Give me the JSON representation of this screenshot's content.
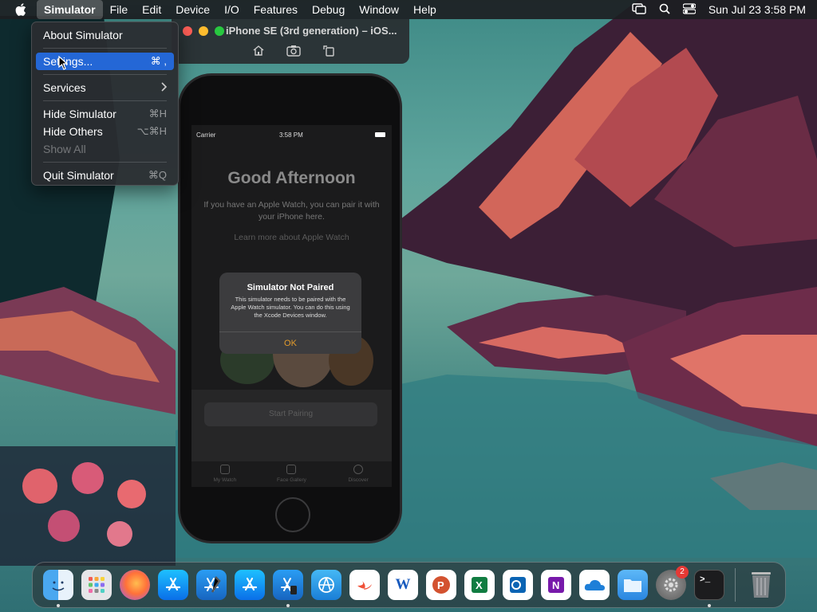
{
  "menubar": {
    "app": "Simulator",
    "items": [
      "File",
      "Edit",
      "Device",
      "I/O",
      "Features",
      "Debug",
      "Window",
      "Help"
    ],
    "clock": "Sun Jul 23  3:58 PM"
  },
  "app_menu": {
    "about": "About Simulator",
    "settings": "Settings...",
    "settings_shortcut": "⌘ ,",
    "services": "Services",
    "hide": "Hide Simulator",
    "hide_shortcut": "⌘H",
    "hide_others": "Hide Others",
    "hide_others_shortcut": "⌥⌘H",
    "show_all": "Show All",
    "quit": "Quit Simulator",
    "quit_shortcut": "⌘Q"
  },
  "simulator_window": {
    "title": "iPhone SE (3rd generation) – iOS..."
  },
  "phone": {
    "carrier": "Carrier",
    "time": "3:58 PM",
    "greeting": "Good Afternoon",
    "subtitle": "If you have an Apple Watch, you can pair it with your iPhone here.",
    "learn_more": "Learn more about Apple Watch",
    "start_pairing": "Start Pairing",
    "tabs": [
      "My Watch",
      "Face Gallery",
      "Discover"
    ]
  },
  "alert": {
    "title": "Simulator Not Paired",
    "message": "This simulator needs to be paired with the Apple Watch simulator. You can do this using the Xcode Devices window.",
    "button": "OK"
  },
  "dock": {
    "apps": [
      "Finder",
      "Launchpad",
      "Firefox",
      "App Store",
      "Xcode",
      "App Store",
      "Simulator",
      "Network Utility",
      "Swift Playgrounds",
      "Microsoft Word",
      "Microsoft PowerPoint",
      "Microsoft Excel",
      "Microsoft Outlook",
      "Microsoft OneNote",
      "OneDrive",
      "Files",
      "System Settings",
      "Terminal",
      "Trash"
    ],
    "settings_badge": "2"
  }
}
